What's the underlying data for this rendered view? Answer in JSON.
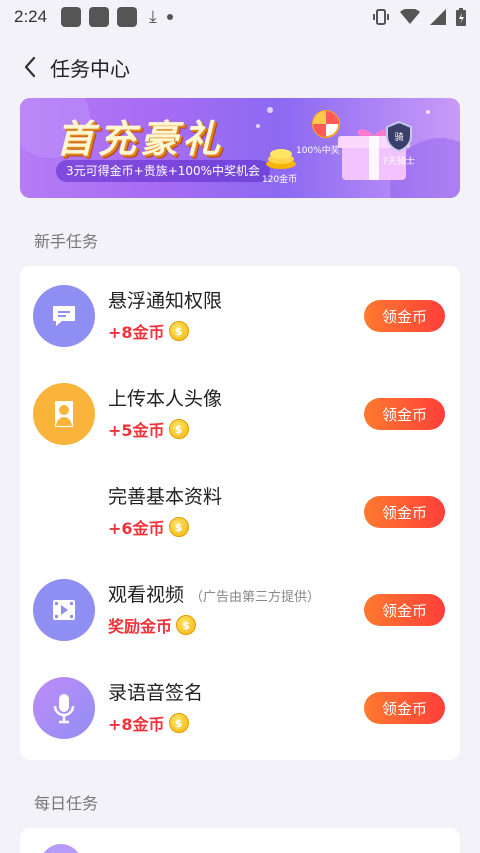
{
  "status": {
    "time": "2:24",
    "download_icon": "download-icon"
  },
  "header": {
    "title": "任务中心",
    "back_icon": "back-arrow-icon"
  },
  "banner": {
    "title": "首充豪礼",
    "subtitle": "3元可得金币+贵族+100%中奖机会",
    "badge_coins": "120金币",
    "badge_lottery": "100%中奖",
    "badge_knight": "7天骑士",
    "colors": {
      "bg_start": "#b57cf5",
      "bg_end": "#c99bf7"
    }
  },
  "sections": {
    "newbie": "新手任务",
    "daily": "每日任务"
  },
  "tasks": [
    {
      "title": "悬浮通知权限",
      "note": "",
      "reward": "+8金币",
      "button": "领金币",
      "icon": "message-icon",
      "icon_bg": "#8f8ef3"
    },
    {
      "title": "上传本人头像",
      "note": "",
      "reward": "+5金币",
      "button": "领金币",
      "icon": "user-icon",
      "icon_bg": "#fbb43b"
    },
    {
      "title": "完善基本资料",
      "note": "",
      "reward": "+6金币",
      "button": "领金币",
      "icon": "profile-icon",
      "icon_bg": "#ffffff"
    },
    {
      "title": "观看视频",
      "note": "（广告由第三方提供）",
      "reward": "奖励金币",
      "button": "领金币",
      "icon": "video-icon",
      "icon_bg": "#8f8ef3"
    },
    {
      "title": "录语音签名",
      "note": "",
      "reward": "+8金币",
      "button": "领金币",
      "icon": "microphone-icon",
      "icon_bg": "#a88ef6"
    }
  ],
  "coin_symbol": "$",
  "colors": {
    "accent_red": "#f0343c",
    "button_start": "#ff7a2e",
    "button_end": "#ff3f3a"
  }
}
